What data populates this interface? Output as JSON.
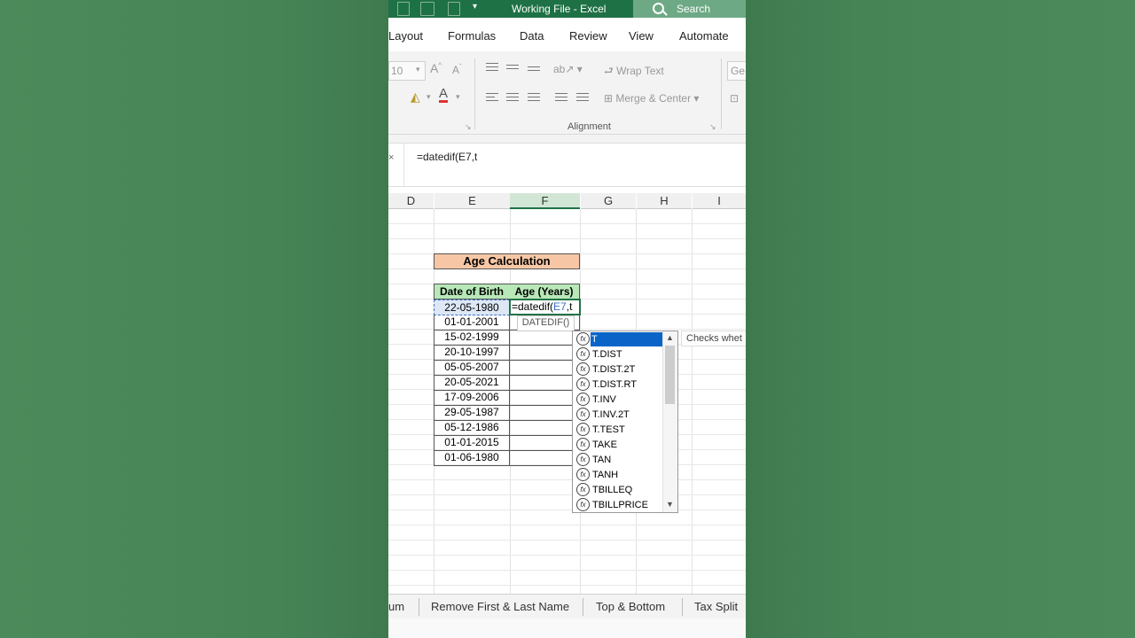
{
  "app": {
    "window_title": "Working File  -  Excel",
    "search_label": "Search"
  },
  "ribbon": {
    "tabs": [
      "Layout",
      "Formulas",
      "Data",
      "Review",
      "View",
      "Automate"
    ],
    "font_size_value": "10",
    "wrap_text_label": "Wrap Text",
    "merge_center_label": "Merge & Center",
    "number_format_partial": "Ge",
    "group_alignment_label": "Alignment"
  },
  "formula_bar": {
    "cancel_glyph": "×",
    "content": "=datedif(E7,t"
  },
  "columns": [
    "D",
    "E",
    "F",
    "G",
    "H",
    "I"
  ],
  "sheet": {
    "title": "Age Calculation",
    "header_dob": "Date of Birth",
    "header_age": "Age (Years)",
    "dates": [
      "22-05-1980",
      "01-01-2001",
      "15-02-1999",
      "20-10-1997",
      "05-05-2007",
      "20-05-2021",
      "17-09-2006",
      "29-05-1987",
      "05-12-1986",
      "01-01-2015",
      "01-06-1980"
    ],
    "editing_prefix": "=datedif(",
    "editing_ref": "E7",
    "editing_suffix": ",t"
  },
  "tooltip": {
    "syntax": "DATEDIF()",
    "description": "Checks whet"
  },
  "autocomplete": {
    "fx_glyph": "fx",
    "items": [
      "T",
      "T.DIST",
      "T.DIST.2T",
      "T.DIST.RT",
      "T.INV",
      "T.INV.2T",
      "T.TEST",
      "TAKE",
      "TAN",
      "TANH",
      "TBILLEQ",
      "TBILLPRICE"
    ],
    "selected_index": 0
  },
  "sheet_tabs": [
    "um",
    "Remove First & Last Name",
    "Top & Bottom",
    "Tax Split"
  ],
  "colors": {
    "excel_green": "#217346",
    "title_fill": "#f7c7a5",
    "header_fill": "#b8e8b8",
    "selection_blue": "#0a64c8"
  }
}
